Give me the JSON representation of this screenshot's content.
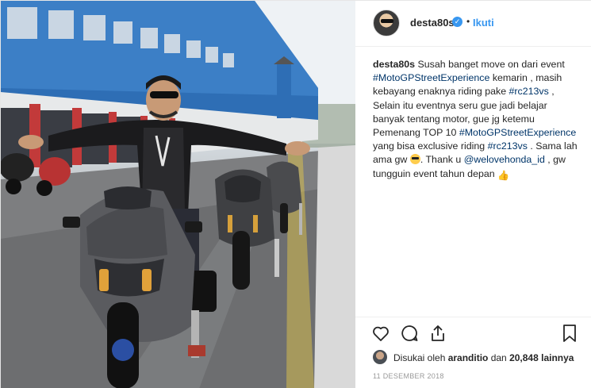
{
  "post": {
    "username": "desta80s",
    "verified_icon": "check-verified-icon",
    "separator": "•",
    "follow_label": "Ikuti",
    "caption": {
      "username": "desta80s",
      "t1": " Susah banget move on dari event ",
      "tag1": "#MotoGPStreetExperience",
      "t2": " kemarin , masih kebayang enaknya riding pake ",
      "tag2": "#rc213vs",
      "t3": " , Selain itu eventnya seru gue jadi belajar banyak tentang motor, gue jg ketemu Pemenang TOP 10 ",
      "tag3": "#MotoGPStreetExperience",
      "t4": " yang bisa exclusive riding ",
      "tag4": "#rc213vs",
      "t5": " . Sama lah ama gw ",
      "t6": ". Thank u ",
      "mention": "@welovehonda_id",
      "t7": " , gw tungguin event tahun depan "
    },
    "likes": {
      "prefix": "Disukai oleh ",
      "user": "aranditio",
      "middle": " dan ",
      "count": "20,848",
      "suffix": " lainnya"
    },
    "date": "11 DESEMBER 2018",
    "icons": {
      "like": "heart-icon",
      "comment": "comment-icon",
      "share": "share-icon",
      "save": "bookmark-icon"
    },
    "colors": {
      "link": "#003569",
      "accent": "#3897f0",
      "text": "#262626",
      "muted": "#999999"
    }
  }
}
